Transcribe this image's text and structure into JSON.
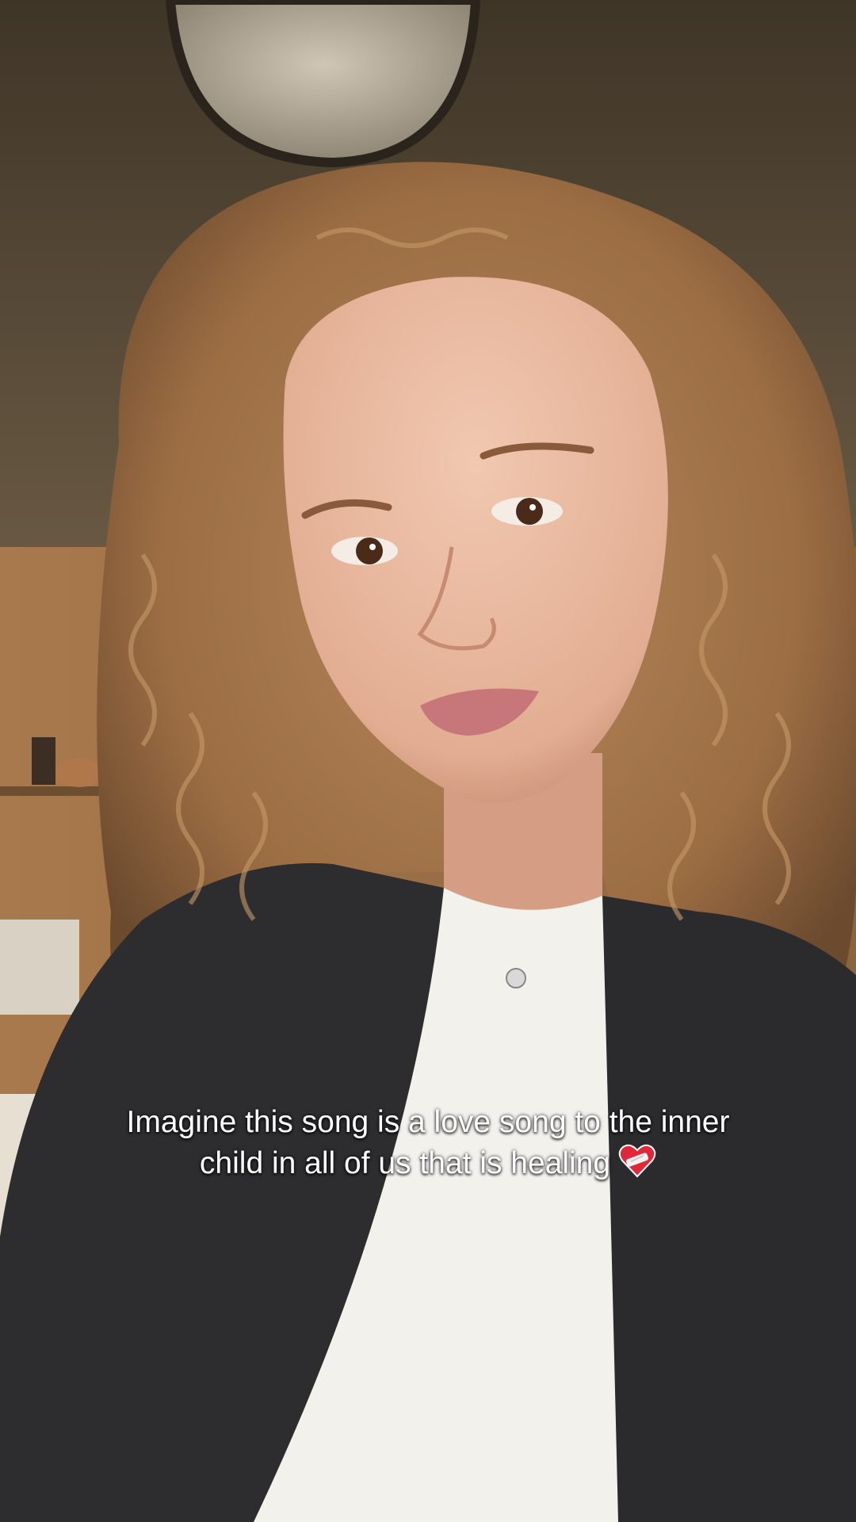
{
  "caption": {
    "line1": "Imagine this song is a love song to the inner",
    "line2": "child in all of us that is healing"
  },
  "icons": {
    "caption_emoji": "mending-heart-icon"
  },
  "colors": {
    "ceiling": "#4d4130",
    "wall": "#a8794c",
    "hair": "#a9784a",
    "skin": "#e7b79c",
    "cardigan": "#2d2d30",
    "top": "#f3f1ec",
    "caption_text": "#ffffff"
  }
}
